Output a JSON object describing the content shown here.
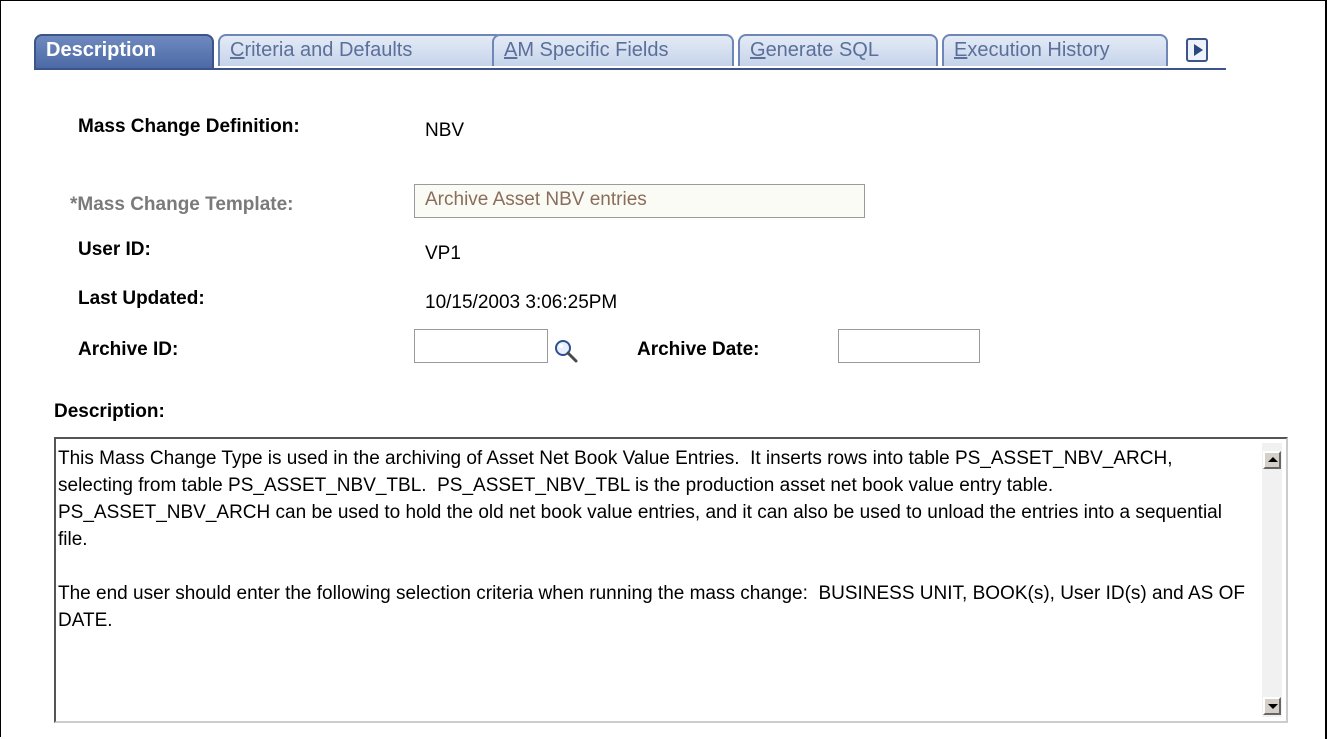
{
  "tabs": [
    {
      "label": "Description",
      "underline": "",
      "rest": "Description"
    },
    {
      "underline": "C",
      "rest": "riteria and Defaults"
    },
    {
      "underline": "A",
      "rest": "M Specific Fields"
    },
    {
      "underline": "G",
      "rest": "enerate SQL"
    },
    {
      "underline": "E",
      "rest": "xecution History"
    }
  ],
  "form": {
    "mass_change_definition_label": "Mass Change Definition:",
    "mass_change_definition_value": "NBV",
    "mass_change_template_label": "*Mass Change Template:",
    "mass_change_template_value": "Archive Asset NBV entries",
    "user_id_label": "User ID:",
    "user_id_value": "VP1",
    "last_updated_label": "Last Updated:",
    "last_updated_value": "10/15/2003  3:06:25PM",
    "archive_id_label": "Archive ID:",
    "archive_id_value": "",
    "archive_date_label": "Archive Date:",
    "archive_date_value": "",
    "description_label": "Description:",
    "description_paragraph_1": "This Mass Change Type is used in the archiving of Asset Net Book Value Entries.  It inserts rows into table PS_ASSET_NBV_ARCH, selecting from table PS_ASSET_NBV_TBL.  PS_ASSET_NBV_TBL is the production asset net book value entry table.  PS_ASSET_NBV_ARCH can be used to hold the old net book value entries, and it can also be used to unload the entries into a sequential file.",
    "description_paragraph_2": "The end user should enter the following selection criteria when running the mass change:  BUSINESS UNIT, BOOK(s), User ID(s) and AS OF DATE."
  },
  "icons": {
    "lookup": "magnifier-icon",
    "next_tab": "next-tab-arrow-icon"
  }
}
